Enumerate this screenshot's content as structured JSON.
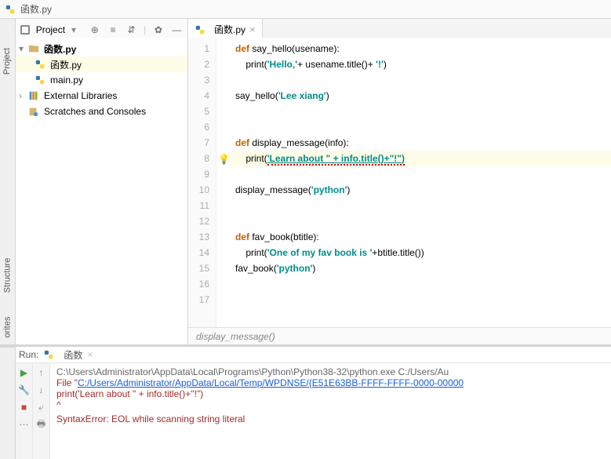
{
  "title": "函数.py",
  "project_header": {
    "label": "Project"
  },
  "tree": {
    "root": "函数.py",
    "items": [
      "函数.py",
      "main.py"
    ],
    "ext": "External Libraries",
    "scratch": "Scratches and Consoles"
  },
  "tab": {
    "name": "函数.py"
  },
  "gutter": [
    "1",
    "2",
    "3",
    "4",
    "5",
    "6",
    "7",
    "8",
    "9",
    "10",
    "11",
    "12",
    "13",
    "14",
    "15",
    "16",
    "17"
  ],
  "code": {
    "l1_def": "def ",
    "l1_fn": "say_hello",
    "l1_rest": "(usename):",
    "l2_a": "    print(",
    "l2_s": "'Hello,'",
    "l2_b": "+ usename.title()+ ",
    "l2_s2": "'!'",
    "l2_c": ")",
    "l4_a": "say_hello(",
    "l4_s": "'Lee xiang'",
    "l4_b": ")",
    "l7_def": "def ",
    "l7_fn": "display_message",
    "l7_rest": "(info):",
    "l8_a": "    print(",
    "l8_s": "'Learn about \" + info.title()+\"!\")",
    "l10_a": "display_message(",
    "l10_s": "'python'",
    "l10_b": ")",
    "l13_def": "def ",
    "l13_fn": "fav_book",
    "l13_rest": "(btitle):",
    "l14_a": "    print(",
    "l14_s": "'One of my fav book is '",
    "l14_b": "+btitle.title())",
    "l15_a": "fav_book(",
    "l15_s": "'python'",
    "l15_b": ")"
  },
  "breadcrumb": "display_message()",
  "run": {
    "label": "Run:",
    "tab": "函数",
    "l1": "C:\\Users\\Administrator\\AppData\\Local\\Programs\\Python\\Python38-32\\python.exe C:/Users/Au",
    "l2a": "    File \"",
    "l2link": "C:/Users/Administrator/AppData/Local/Temp/WPDNSE/{E51E63BB-FFFF-FFFF-0000-00000",
    "l3": "      print('Learn about \" + info.title()+\"!\")",
    "l4": "                                              ^",
    "l5": "SyntaxError: EOL while scanning string literal"
  }
}
